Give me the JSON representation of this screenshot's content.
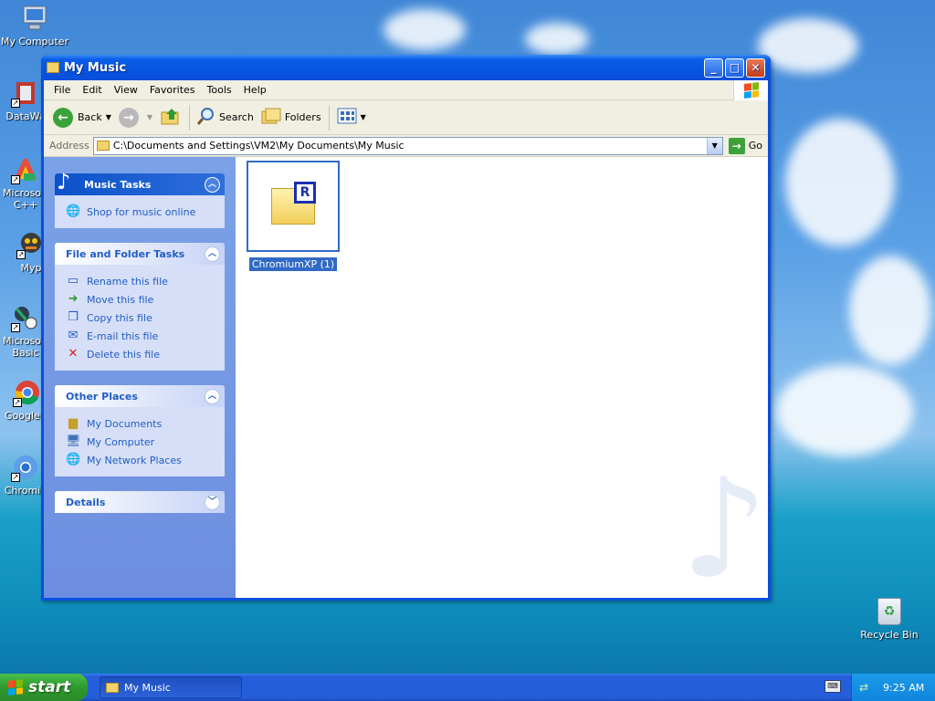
{
  "desktop": {
    "icons": [
      {
        "label": "My Computer"
      },
      {
        "label": "DataWa"
      },
      {
        "label": "Microsoft C++"
      },
      {
        "label": "Myp"
      },
      {
        "label": "Microsoft Basic"
      },
      {
        "label": "Google C"
      },
      {
        "label": "Chromiu"
      }
    ],
    "recycle_bin": "Recycle Bin"
  },
  "window": {
    "title": "My Music",
    "menu": [
      "File",
      "Edit",
      "View",
      "Favorites",
      "Tools",
      "Help"
    ],
    "toolbar": {
      "back": "Back",
      "search": "Search",
      "folders": "Folders"
    },
    "address": {
      "label": "Address",
      "value": "C:\\Documents and Settings\\VM2\\My Documents\\My Music",
      "go": "Go"
    },
    "taskpane": {
      "music_tasks": {
        "title": "Music Tasks",
        "items": [
          "Shop for music online"
        ]
      },
      "file_tasks": {
        "title": "File and Folder Tasks",
        "items": [
          "Rename this file",
          "Move this file",
          "Copy this file",
          "E-mail this file",
          "Delete this file"
        ]
      },
      "other_places": {
        "title": "Other Places",
        "items": [
          "My Documents",
          "My Computer",
          "My Network Places"
        ]
      },
      "details": {
        "title": "Details"
      }
    },
    "files": [
      {
        "name": "ChromiumXP (1)",
        "badge": "R"
      }
    ]
  },
  "taskbar": {
    "start": "start",
    "task_button": "My Music",
    "clock": "9:25 AM"
  },
  "colors": {
    "xp_blue": "#0a4ee0",
    "link_blue": "#215dc6",
    "selection": "#316ac5",
    "start_green": "#2e9a2e"
  }
}
